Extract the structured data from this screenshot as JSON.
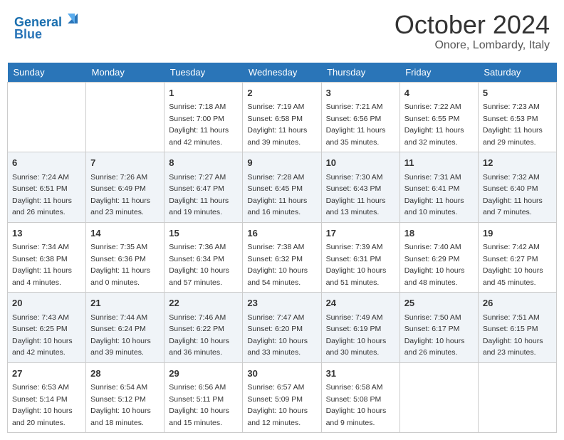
{
  "header": {
    "logo_line1": "General",
    "logo_line2": "Blue",
    "month": "October 2024",
    "location": "Onore, Lombardy, Italy"
  },
  "days_of_week": [
    "Sunday",
    "Monday",
    "Tuesday",
    "Wednesday",
    "Thursday",
    "Friday",
    "Saturday"
  ],
  "weeks": [
    [
      {
        "day": "",
        "sunrise": "",
        "sunset": "",
        "daylight": ""
      },
      {
        "day": "",
        "sunrise": "",
        "sunset": "",
        "daylight": ""
      },
      {
        "day": "1",
        "sunrise": "Sunrise: 7:18 AM",
        "sunset": "Sunset: 7:00 PM",
        "daylight": "Daylight: 11 hours and 42 minutes."
      },
      {
        "day": "2",
        "sunrise": "Sunrise: 7:19 AM",
        "sunset": "Sunset: 6:58 PM",
        "daylight": "Daylight: 11 hours and 39 minutes."
      },
      {
        "day": "3",
        "sunrise": "Sunrise: 7:21 AM",
        "sunset": "Sunset: 6:56 PM",
        "daylight": "Daylight: 11 hours and 35 minutes."
      },
      {
        "day": "4",
        "sunrise": "Sunrise: 7:22 AM",
        "sunset": "Sunset: 6:55 PM",
        "daylight": "Daylight: 11 hours and 32 minutes."
      },
      {
        "day": "5",
        "sunrise": "Sunrise: 7:23 AM",
        "sunset": "Sunset: 6:53 PM",
        "daylight": "Daylight: 11 hours and 29 minutes."
      }
    ],
    [
      {
        "day": "6",
        "sunrise": "Sunrise: 7:24 AM",
        "sunset": "Sunset: 6:51 PM",
        "daylight": "Daylight: 11 hours and 26 minutes."
      },
      {
        "day": "7",
        "sunrise": "Sunrise: 7:26 AM",
        "sunset": "Sunset: 6:49 PM",
        "daylight": "Daylight: 11 hours and 23 minutes."
      },
      {
        "day": "8",
        "sunrise": "Sunrise: 7:27 AM",
        "sunset": "Sunset: 6:47 PM",
        "daylight": "Daylight: 11 hours and 19 minutes."
      },
      {
        "day": "9",
        "sunrise": "Sunrise: 7:28 AM",
        "sunset": "Sunset: 6:45 PM",
        "daylight": "Daylight: 11 hours and 16 minutes."
      },
      {
        "day": "10",
        "sunrise": "Sunrise: 7:30 AM",
        "sunset": "Sunset: 6:43 PM",
        "daylight": "Daylight: 11 hours and 13 minutes."
      },
      {
        "day": "11",
        "sunrise": "Sunrise: 7:31 AM",
        "sunset": "Sunset: 6:41 PM",
        "daylight": "Daylight: 11 hours and 10 minutes."
      },
      {
        "day": "12",
        "sunrise": "Sunrise: 7:32 AM",
        "sunset": "Sunset: 6:40 PM",
        "daylight": "Daylight: 11 hours and 7 minutes."
      }
    ],
    [
      {
        "day": "13",
        "sunrise": "Sunrise: 7:34 AM",
        "sunset": "Sunset: 6:38 PM",
        "daylight": "Daylight: 11 hours and 4 minutes."
      },
      {
        "day": "14",
        "sunrise": "Sunrise: 7:35 AM",
        "sunset": "Sunset: 6:36 PM",
        "daylight": "Daylight: 11 hours and 0 minutes."
      },
      {
        "day": "15",
        "sunrise": "Sunrise: 7:36 AM",
        "sunset": "Sunset: 6:34 PM",
        "daylight": "Daylight: 10 hours and 57 minutes."
      },
      {
        "day": "16",
        "sunrise": "Sunrise: 7:38 AM",
        "sunset": "Sunset: 6:32 PM",
        "daylight": "Daylight: 10 hours and 54 minutes."
      },
      {
        "day": "17",
        "sunrise": "Sunrise: 7:39 AM",
        "sunset": "Sunset: 6:31 PM",
        "daylight": "Daylight: 10 hours and 51 minutes."
      },
      {
        "day": "18",
        "sunrise": "Sunrise: 7:40 AM",
        "sunset": "Sunset: 6:29 PM",
        "daylight": "Daylight: 10 hours and 48 minutes."
      },
      {
        "day": "19",
        "sunrise": "Sunrise: 7:42 AM",
        "sunset": "Sunset: 6:27 PM",
        "daylight": "Daylight: 10 hours and 45 minutes."
      }
    ],
    [
      {
        "day": "20",
        "sunrise": "Sunrise: 7:43 AM",
        "sunset": "Sunset: 6:25 PM",
        "daylight": "Daylight: 10 hours and 42 minutes."
      },
      {
        "day": "21",
        "sunrise": "Sunrise: 7:44 AM",
        "sunset": "Sunset: 6:24 PM",
        "daylight": "Daylight: 10 hours and 39 minutes."
      },
      {
        "day": "22",
        "sunrise": "Sunrise: 7:46 AM",
        "sunset": "Sunset: 6:22 PM",
        "daylight": "Daylight: 10 hours and 36 minutes."
      },
      {
        "day": "23",
        "sunrise": "Sunrise: 7:47 AM",
        "sunset": "Sunset: 6:20 PM",
        "daylight": "Daylight: 10 hours and 33 minutes."
      },
      {
        "day": "24",
        "sunrise": "Sunrise: 7:49 AM",
        "sunset": "Sunset: 6:19 PM",
        "daylight": "Daylight: 10 hours and 30 minutes."
      },
      {
        "day": "25",
        "sunrise": "Sunrise: 7:50 AM",
        "sunset": "Sunset: 6:17 PM",
        "daylight": "Daylight: 10 hours and 26 minutes."
      },
      {
        "day": "26",
        "sunrise": "Sunrise: 7:51 AM",
        "sunset": "Sunset: 6:15 PM",
        "daylight": "Daylight: 10 hours and 23 minutes."
      }
    ],
    [
      {
        "day": "27",
        "sunrise": "Sunrise: 6:53 AM",
        "sunset": "Sunset: 5:14 PM",
        "daylight": "Daylight: 10 hours and 20 minutes."
      },
      {
        "day": "28",
        "sunrise": "Sunrise: 6:54 AM",
        "sunset": "Sunset: 5:12 PM",
        "daylight": "Daylight: 10 hours and 18 minutes."
      },
      {
        "day": "29",
        "sunrise": "Sunrise: 6:56 AM",
        "sunset": "Sunset: 5:11 PM",
        "daylight": "Daylight: 10 hours and 15 minutes."
      },
      {
        "day": "30",
        "sunrise": "Sunrise: 6:57 AM",
        "sunset": "Sunset: 5:09 PM",
        "daylight": "Daylight: 10 hours and 12 minutes."
      },
      {
        "day": "31",
        "sunrise": "Sunrise: 6:58 AM",
        "sunset": "Sunset: 5:08 PM",
        "daylight": "Daylight: 10 hours and 9 minutes."
      },
      {
        "day": "",
        "sunrise": "",
        "sunset": "",
        "daylight": ""
      },
      {
        "day": "",
        "sunrise": "",
        "sunset": "",
        "daylight": ""
      }
    ]
  ]
}
